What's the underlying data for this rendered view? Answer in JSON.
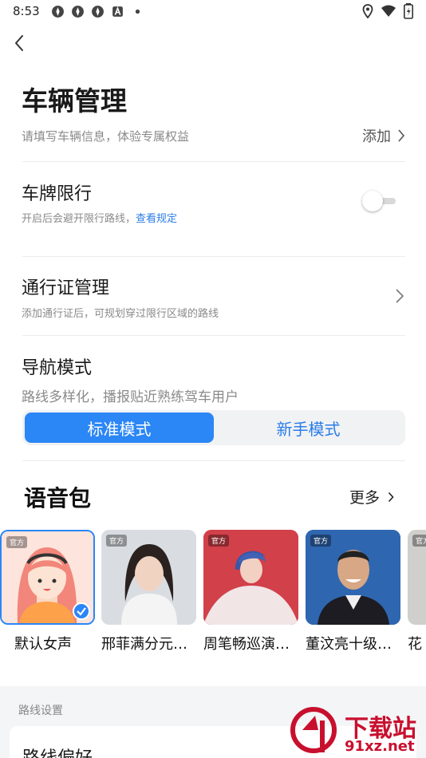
{
  "status_bar": {
    "time": "8:53"
  },
  "vehicle": {
    "title": "车辆管理",
    "subtitle": "请填写车辆信息，体验专属权益",
    "add_label": "添加"
  },
  "plate_limit": {
    "title": "车牌限行",
    "desc": "开启后会避开限行路线，",
    "link": "查看规定",
    "enabled": false
  },
  "permit": {
    "title": "通行证管理",
    "desc": "添加通行证后，可规划穿过限行区域的路线"
  },
  "nav_mode": {
    "title": "导航模式",
    "desc": "路线多样化，播报贴近熟练驾车用户",
    "options": [
      "标准模式",
      "新手模式"
    ],
    "selected": "标准模式"
  },
  "voice_pack": {
    "title": "语音包",
    "more_label": "更多",
    "badge": "官方",
    "items": [
      {
        "name": "默认女声"
      },
      {
        "name": "邢菲满分元…"
      },
      {
        "name": "周笔畅巡演…"
      },
      {
        "name": "董汶亮十级…"
      },
      {
        "name": "花"
      }
    ]
  },
  "route_settings": {
    "section_label": "路线设置",
    "card_title": "路线偏好"
  },
  "watermark": {
    "text": "下载站",
    "url": "91xz.net"
  },
  "colors": {
    "accent": "#2b86f6",
    "link": "#2b7de9"
  }
}
